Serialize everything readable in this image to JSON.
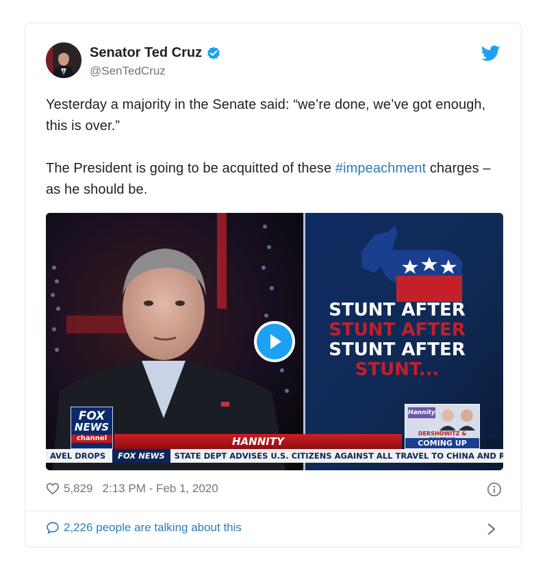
{
  "tweet": {
    "author_name": "Senator Ted Cruz",
    "handle": "@SenTedCruz",
    "text_paragraph_1": "Yesterday a majority in the Senate said: “we’re done, we’ve got enough, this is over.”",
    "text_paragraph_2_before": "The President is going to be acquitted of these ",
    "hashtag": "#impeachment",
    "text_paragraph_2_after": " charges – as he should be.",
    "like_count": "5,829",
    "timestamp": "2:13 PM - Feb 1, 2020",
    "talking_text": "2,226 people are talking about this"
  },
  "video": {
    "stunt_lines": [
      "STUNT AFTER",
      "STUNT AFTER",
      "STUNT AFTER",
      "STUNT..."
    ],
    "fox_logo_line1": "FOX",
    "fox_logo_line2": "NEWS",
    "fox_logo_line3": "channel",
    "show_name": "HANNITY",
    "coming_badge": "Hannity",
    "coming_names": "DERSHOWITZ & PRIEBUS",
    "coming_up": "COMING UP",
    "ticker_left": "AVEL DROPS",
    "ticker_network": "FOX NEWS",
    "ticker_text": "STATE DEPT ADVISES U.S. CITIZENS AGAINST ALL TRAVEL TO CHINA AND REC"
  },
  "icons": {
    "verified": "verified-badge-icon",
    "brand": "twitter-bird-icon",
    "like": "heart-icon",
    "info": "info-icon",
    "reply": "speech-bubble-icon",
    "more": "chevron-right-icon"
  },
  "colors": {
    "link": "#2b7bb9",
    "twitter_blue": "#1da1f2",
    "muted": "#697882",
    "border": "#e1e8ed"
  }
}
